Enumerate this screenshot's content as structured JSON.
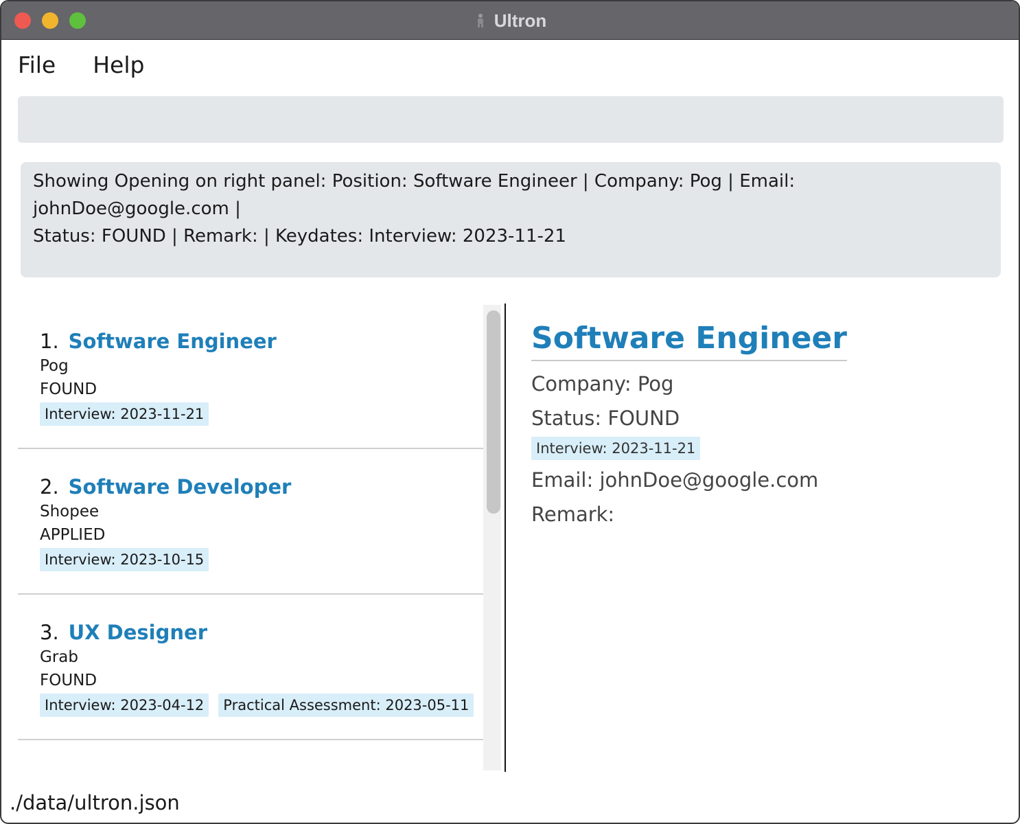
{
  "window": {
    "title": "Ultron"
  },
  "menu": [
    "File",
    "Help"
  ],
  "command_box": {
    "value": "",
    "placeholder": ""
  },
  "result_display": {
    "line1": "Showing Opening on right panel: Position: Software Engineer | Company: Pog | Email: johnDoe@google.com |",
    "line2": "Status: FOUND | Remark:  | Keydates: Interview: 2023-11-21"
  },
  "openings": [
    {
      "index": "1.",
      "position": "Software Engineer",
      "company": "Pog",
      "status": "FOUND",
      "dates": [
        "Interview: 2023-11-21"
      ]
    },
    {
      "index": "2.",
      "position": "Software Developer",
      "company": "Shopee",
      "status": "APPLIED",
      "dates": [
        "Interview: 2023-10-15"
      ]
    },
    {
      "index": "3.",
      "position": "UX Designer",
      "company": "Grab",
      "status": "FOUND",
      "dates": [
        "Interview: 2023-04-12",
        "Practical Assessment: 2023-05-11"
      ]
    }
  ],
  "detail": {
    "position": "Software Engineer",
    "company": "Company: Pog",
    "status": "Status: FOUND",
    "date_tag": "Interview: 2023-11-21",
    "email": "Email: johnDoe@google.com",
    "remark": "Remark:"
  },
  "status_bar": {
    "path": "./data/ultron.json"
  },
  "colors": {
    "accent": "#1f7fb9",
    "tag_bg": "#d8eef9",
    "box_bg": "#e4e7ea"
  }
}
